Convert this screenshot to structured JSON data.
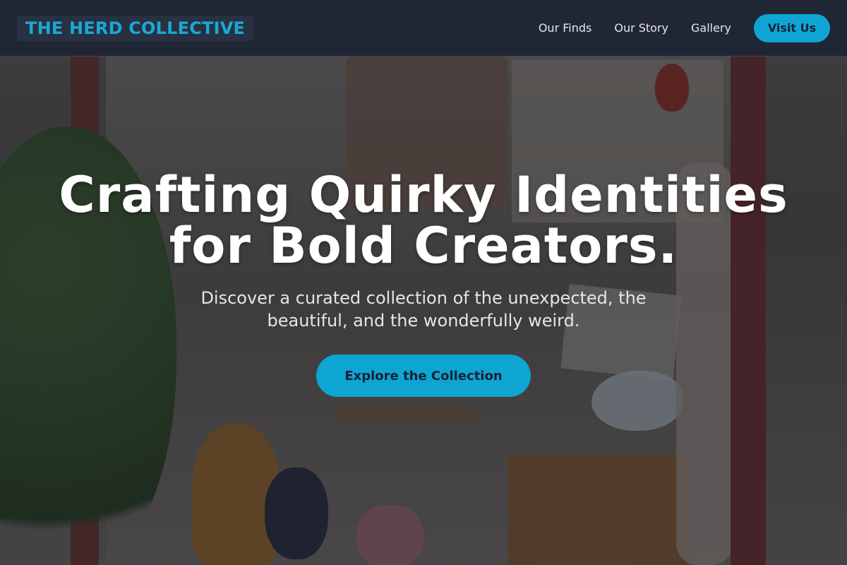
{
  "header": {
    "brand": "THE HERD COLLECTIVE",
    "nav": [
      {
        "label": "Our Finds"
      },
      {
        "label": "Our Story"
      },
      {
        "label": "Gallery"
      }
    ],
    "cta_label": "Visit Us"
  },
  "hero": {
    "title_line1": "Crafting Quirky Identities",
    "title_line2": "for Bold Creators.",
    "subtitle": "Discover a curated collection of the unexpected, the beautiful, and the wonderfully weird.",
    "button_label": "Explore the Collection"
  },
  "colors": {
    "accent": "#0ea5d2",
    "header_bg": "#1e2533",
    "brand_text": "#1aa8d6"
  }
}
